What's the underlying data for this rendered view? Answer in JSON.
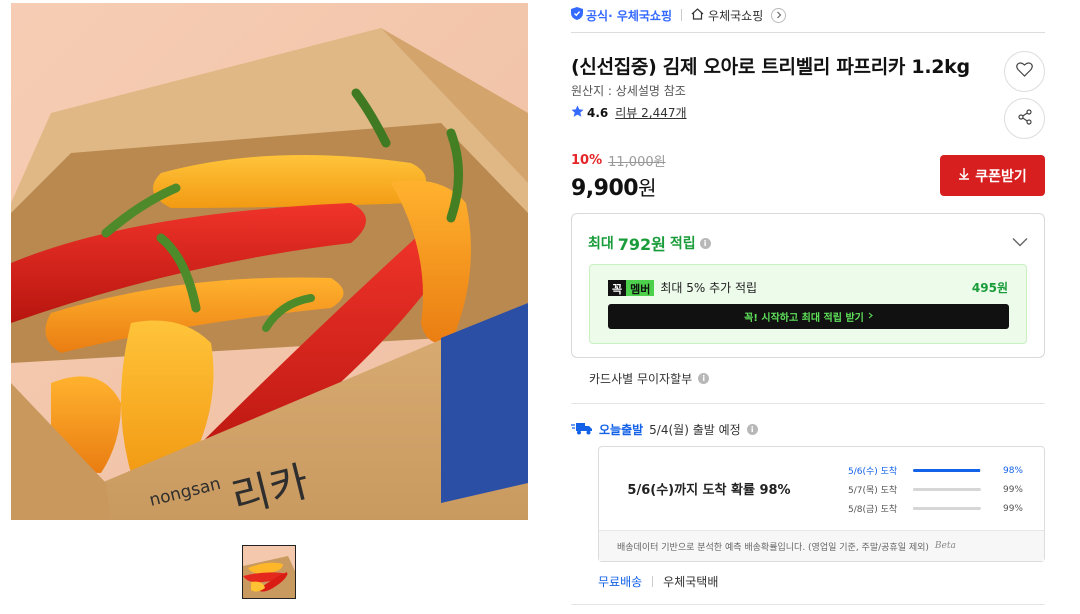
{
  "store": {
    "official_label": "공식· 우체국쇼핑",
    "store_name": "우체국쇼핑"
  },
  "product": {
    "title": "(신선집중) 김제 오아로 트리벨리 파프리카 1.2kg",
    "origin": "원산지 : 상세설명 참조",
    "rating": "4.6",
    "review_label": "리뷰 2,447개",
    "image_box_texts": {
      "brand": "nongsan",
      "partial_text": "리카"
    }
  },
  "price": {
    "discount": "10%",
    "original": "11,000원",
    "sale_number": "9,900",
    "sale_unit": "원"
  },
  "coupon": {
    "label": "쿠폰받기"
  },
  "reward": {
    "prefix": "최대",
    "amount": "792원",
    "suffix": "적립",
    "member_badge_1": "꼭",
    "member_badge_2": "멤버",
    "member_text": "최대 5% 추가 적립",
    "member_amount": "495원",
    "member_cta": "꼭! 시작하고 최대 적립 받기"
  },
  "card": {
    "label": "카드사별 무이자할부"
  },
  "shipping": {
    "today_label": "오늘출발",
    "schedule": "5/4(월) 출발 예정",
    "probability_main": "5/6(수)까지 도착 확률 98%",
    "probabilities": [
      {
        "label": "5/6(수) 도착",
        "pct": "98%",
        "value": 0.98
      },
      {
        "label": "5/7(목) 도착",
        "pct": "99%",
        "value": 0.99
      },
      {
        "label": "5/8(금) 도착",
        "pct": "99%",
        "value": 0.99
      }
    ],
    "footnote": "배송데이터 기반으로 분석한 예측 배송확률입니다. (영업일 기준, 주말/공휴일 제외)",
    "beta": "Beta"
  },
  "delivery": {
    "fee": "무료배송",
    "carrier": "우체국택배"
  },
  "colors": {
    "accent_red": "#d81f1f",
    "discount_red": "#e52528",
    "reward_green": "#1a9c3a",
    "link_blue": "#346aff",
    "ship_blue": "#1462e8"
  },
  "icons": [
    "shield-icon",
    "home-icon",
    "chevron-right-icon",
    "heart-icon",
    "share-icon",
    "star-icon",
    "download-arrow-icon",
    "info-icon",
    "chevron-down-icon",
    "delivery-truck-icon"
  ]
}
